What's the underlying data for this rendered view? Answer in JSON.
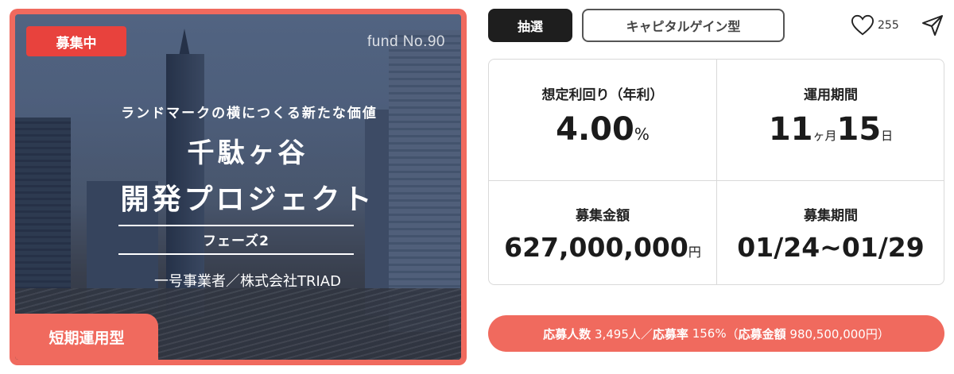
{
  "hero": {
    "status_badge": "募集中",
    "fund_number": "fund No.90",
    "tagline": "ランドマークの横につくる新たな価値",
    "title_line1": "千駄ヶ谷",
    "title_line2": "開発プロジェクト",
    "phase": "フェーズ2",
    "operator": "一号事業者／株式会社TRIAD",
    "term_badge": "短期運用型"
  },
  "tags": {
    "lottery": "抽選",
    "investment_type": "キャピタルゲイン型"
  },
  "actions": {
    "like_count": "255",
    "icons": [
      "heart-icon",
      "share-icon"
    ]
  },
  "stats": {
    "yield": {
      "label": "想定利回り（年利）",
      "value": "4.00",
      "unit": "%"
    },
    "period": {
      "label": "運用期間",
      "months": "11",
      "months_unit": "ヶ月",
      "days": "15",
      "days_unit": "日"
    },
    "amount": {
      "label": "募集金額",
      "value": "627,000,000",
      "unit": "円"
    },
    "recruit_period": {
      "label": "募集期間",
      "value": "01/24~01/29"
    }
  },
  "applicants": {
    "count_label": "応募人数",
    "count_value": "3,495人",
    "separator": "／",
    "rate_label": "応募率",
    "rate_value": "156%",
    "amount_open": "（",
    "amount_label": "応募金額",
    "amount_value": "980,500,000円",
    "amount_close": "）"
  },
  "colors": {
    "accent": "#f06a5e",
    "badge_red": "#e8423d",
    "dark_tag": "#1e1e1e"
  }
}
